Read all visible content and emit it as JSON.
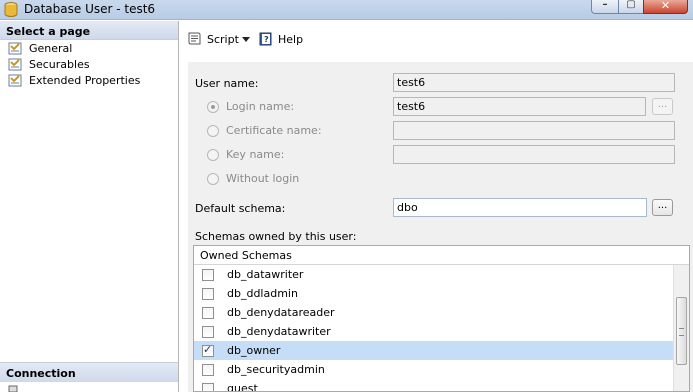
{
  "window": {
    "title": "Database User - test6",
    "min_glyph": "–",
    "max_glyph": "▢",
    "close_glyph": "✕"
  },
  "sidebar": {
    "header": "Select a page",
    "items": [
      {
        "label": "General"
      },
      {
        "label": "Securables"
      },
      {
        "label": "Extended Properties"
      }
    ],
    "connection_header": "Connection"
  },
  "toolbar": {
    "script_label": "Script",
    "help_label": "Help"
  },
  "form": {
    "user_name_label": "User name:",
    "user_name_value": "test6",
    "login_name_label": "Login name:",
    "login_name_value": "test6",
    "certificate_name_label": "Certificate name:",
    "key_name_label": "Key name:",
    "without_login_label": "Without login",
    "default_schema_label": "Default schema:",
    "default_schema_value": "dbo",
    "ellipsis": "...",
    "schemas_owned_label": "Schemas owned by this user:"
  },
  "schemas": {
    "header": "Owned Schemas",
    "rows": [
      {
        "name": "db_datawriter",
        "checked": false
      },
      {
        "name": "db_ddladmin",
        "checked": false
      },
      {
        "name": "db_denydatareader",
        "checked": false
      },
      {
        "name": "db_denydatawriter",
        "checked": false
      },
      {
        "name": "db_owner",
        "checked": true
      },
      {
        "name": "db_securityadmin",
        "checked": false
      },
      {
        "name": "guest",
        "checked": false
      }
    ]
  }
}
